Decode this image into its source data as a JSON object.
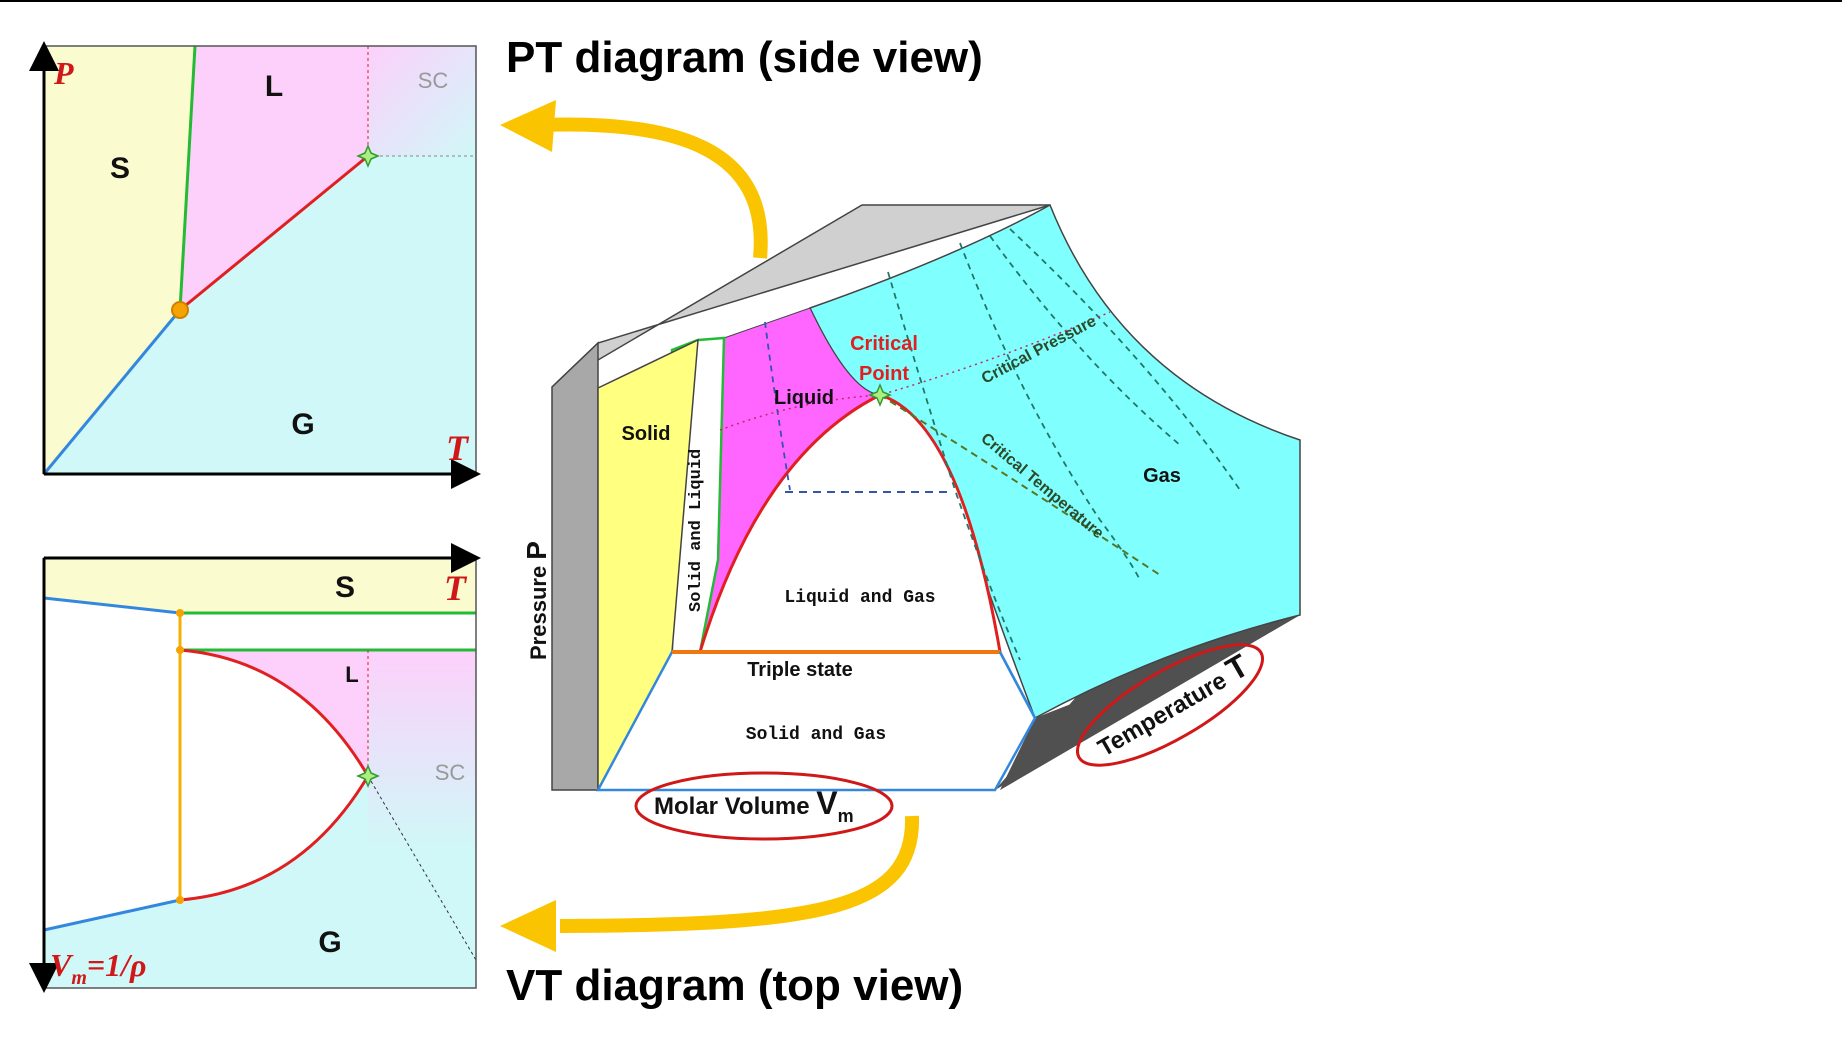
{
  "titles": {
    "pt": "PT diagram (side view)",
    "vt": "VT diagram (top view)"
  },
  "pt_panel": {
    "axis_y": "P",
    "axis_x": "T",
    "region_solid": "S",
    "region_liquid": "L",
    "region_gas": "G",
    "region_supercritical": "SC"
  },
  "vt_panel": {
    "axis_x": "T",
    "axis_y_main": "V",
    "axis_y_sub": "m",
    "axis_y_rest": "=1/ρ",
    "region_solid": "S",
    "region_liquid": "L",
    "region_gas": "G",
    "region_supercritical": "SC"
  },
  "surface3d": {
    "solid": "Solid",
    "solid_liquid": "Solid and Liquid",
    "liquid": "Liquid",
    "critical_point_line1": "Critical",
    "critical_point_line2": "Point",
    "critical_pressure": "Critical Pressure",
    "critical_temperature": "Critical Temperature",
    "gas": "Gas",
    "liquid_gas": "Liquid and Gas",
    "triple_state": "Triple state",
    "solid_gas": "Solid and Gas",
    "pressure_axis_prefix": "Pressure ",
    "pressure_axis_symbol": "P",
    "volume_axis_prefix": "Molar Volume ",
    "volume_axis_symbol": "V",
    "volume_axis_sub": "m",
    "temperature_axis_prefix": "Temperature ",
    "temperature_axis_symbol": "T"
  },
  "colors": {
    "solid": "#fbfbd0",
    "liquid": "#fdd0fb",
    "gas": "#d0f8f8",
    "surface_solid": "#ffff80",
    "surface_liquid": "#ff66ff",
    "surface_gas": "#80ffff",
    "arrow": "#fbc400",
    "critical_red": "#e02020",
    "solid_line": "#22bb33",
    "gas_line": "#3388dd"
  },
  "icons": {
    "arrow_up": "curved-arrow-up-left",
    "arrow_down": "curved-arrow-down-left",
    "critical_marker": "four-point-star",
    "triple_marker": "circle-dot"
  }
}
